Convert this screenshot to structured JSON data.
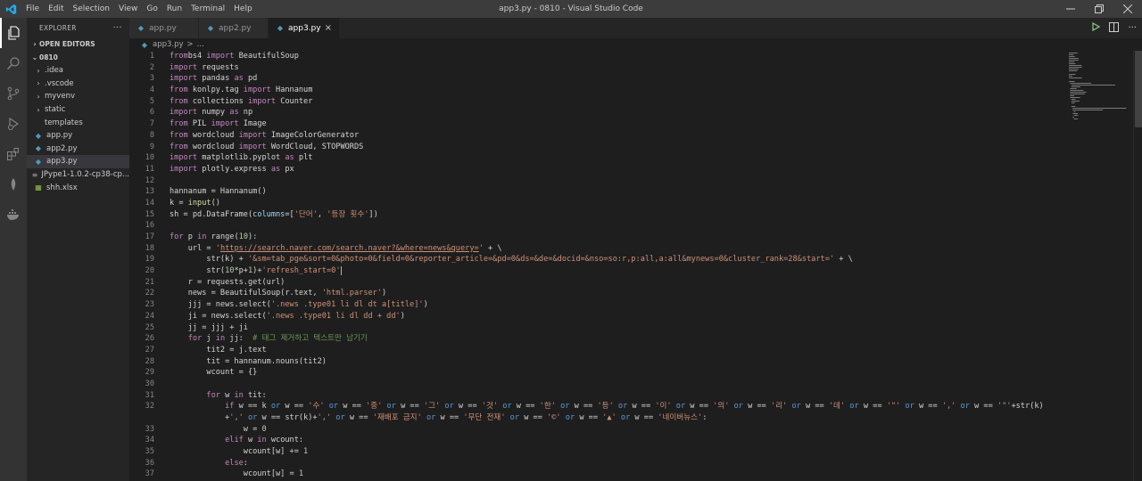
{
  "window": {
    "title": "app3.py - 0810 - Visual Studio Code",
    "menu": [
      "File",
      "Edit",
      "Selection",
      "View",
      "Go",
      "Run",
      "Terminal",
      "Help"
    ]
  },
  "sidebar": {
    "header": "EXPLORER",
    "header_action": "···",
    "open_editors": "OPEN EDITORS",
    "folder": "0810",
    "items": [
      {
        "label": ".idea",
        "type": "folder"
      },
      {
        "label": ".vscode",
        "type": "folder"
      },
      {
        "label": "myvenv",
        "type": "folder"
      },
      {
        "label": "static",
        "type": "folder"
      },
      {
        "label": "templates",
        "type": "folder-open"
      },
      {
        "label": "app.py",
        "type": "python"
      },
      {
        "label": "app2.py",
        "type": "python"
      },
      {
        "label": "app3.py",
        "type": "python"
      },
      {
        "label": "JPype1-1.0.2-cp38-cp...",
        "type": "file"
      },
      {
        "label": "shh.xlsx",
        "type": "excel"
      }
    ]
  },
  "tabs": [
    {
      "label": "app.py"
    },
    {
      "label": "app2.py"
    },
    {
      "label": "app3.py",
      "active": true
    }
  ],
  "breadcrumb": {
    "file": "app3.py",
    "sep": ">",
    "more": "..."
  },
  "colors": {
    "title_bar": "#3c3c3c",
    "activity_bar": "#333333",
    "sidebar": "#252526",
    "editor": "#1e1e1e",
    "python_icon": "#519aba",
    "excel_icon": "#8dc149"
  },
  "code_lines": [
    {
      "n": "1",
      "t": [
        [
          "kw-ctl",
          "from"
        ],
        [
          "",
          "bs4 "
        ],
        [
          "kw-ctl",
          "import"
        ],
        [
          "",
          " BeautifulSoup"
        ]
      ]
    },
    {
      "n": "2",
      "t": [
        [
          "kw-ctl",
          "import"
        ],
        [
          "",
          " requests"
        ]
      ]
    },
    {
      "n": "3",
      "t": [
        [
          "kw-ctl",
          "import"
        ],
        [
          "",
          " pandas "
        ],
        [
          "kw-ctl",
          "as"
        ],
        [
          "",
          " pd"
        ]
      ]
    },
    {
      "n": "4",
      "t": [
        [
          "kw-ctl",
          "from"
        ],
        [
          "",
          " konlpy.tag "
        ],
        [
          "kw-ctl",
          "import"
        ],
        [
          "",
          " Hannanum"
        ]
      ]
    },
    {
      "n": "5",
      "t": [
        [
          "kw-ctl",
          "from"
        ],
        [
          "",
          " collections "
        ],
        [
          "kw-ctl",
          "import"
        ],
        [
          "",
          " Counter"
        ]
      ]
    },
    {
      "n": "6",
      "t": [
        [
          "kw-ctl",
          "import"
        ],
        [
          "",
          " numpy "
        ],
        [
          "kw-ctl",
          "as"
        ],
        [
          "",
          " np"
        ]
      ]
    },
    {
      "n": "7",
      "t": [
        [
          "kw-ctl",
          "from"
        ],
        [
          "",
          " PIL "
        ],
        [
          "kw-ctl",
          "import"
        ],
        [
          "",
          " Image"
        ]
      ]
    },
    {
      "n": "8",
      "t": [
        [
          "kw-ctl",
          "from"
        ],
        [
          "",
          " wordcloud "
        ],
        [
          "kw-ctl",
          "import"
        ],
        [
          "",
          " ImageColorGenerator"
        ]
      ]
    },
    {
      "n": "9",
      "t": [
        [
          "kw-ctl",
          "from"
        ],
        [
          "",
          " wordcloud "
        ],
        [
          "kw-ctl",
          "import"
        ],
        [
          "",
          " WordCloud, STOPWORDS"
        ]
      ]
    },
    {
      "n": "10",
      "t": [
        [
          "kw-ctl",
          "import"
        ],
        [
          "",
          " matplotlib.pyplot "
        ],
        [
          "kw-ctl",
          "as"
        ],
        [
          "",
          " plt"
        ]
      ]
    },
    {
      "n": "11",
      "t": [
        [
          "kw-ctl",
          "import"
        ],
        [
          "",
          " plotly.express "
        ],
        [
          "kw-ctl",
          "as"
        ],
        [
          "",
          " px"
        ]
      ]
    },
    {
      "n": "12",
      "t": []
    },
    {
      "n": "13",
      "t": [
        [
          "",
          "hannanum = Hannanum()"
        ]
      ]
    },
    {
      "n": "14",
      "t": [
        [
          "",
          "k = "
        ],
        [
          "fn",
          "input"
        ],
        [
          "",
          "()"
        ]
      ]
    },
    {
      "n": "15",
      "t": [
        [
          "",
          "sh = pd.DataFrame("
        ],
        [
          "var",
          "columns"
        ],
        [
          "",
          "=["
        ],
        [
          "str",
          "'단어'"
        ],
        [
          "",
          ", "
        ],
        [
          "str",
          "'등장 횟수'"
        ],
        [
          "",
          "])"
        ]
      ]
    },
    {
      "n": "16",
      "t": []
    },
    {
      "n": "17",
      "t": [
        [
          "kw-ctl",
          "for"
        ],
        [
          "",
          " p "
        ],
        [
          "kw-ctl",
          "in"
        ],
        [
          "",
          " range("
        ],
        [
          "num",
          "10"
        ],
        [
          "",
          "):"
        ]
      ]
    },
    {
      "n": "18",
      "t": [
        [
          "",
          "    url = "
        ],
        [
          "str",
          "'"
        ],
        [
          "url",
          "https://search.naver.com/search.naver?&where=news&query="
        ],
        [
          "str",
          "'"
        ],
        [
          "",
          " + \\"
        ]
      ]
    },
    {
      "n": "19",
      "t": [
        [
          "",
          "        str(k) + "
        ],
        [
          "str",
          "'&sm=tab_pge&sort=0&photo=0&field=0&reporter_article=&pd=0&ds=&de=&docid=&nso=so:r,p:all,a:all&mynews=0&cluster_rank=28&start='"
        ],
        [
          "",
          " + \\"
        ]
      ]
    },
    {
      "n": "20",
      "t": [
        [
          "",
          "        str("
        ],
        [
          "num",
          "10"
        ],
        [
          "",
          "*p+"
        ],
        [
          "num",
          "1"
        ],
        [
          "",
          ")+"
        ],
        [
          "str",
          "'refresh_start=0'"
        ],
        [
          "cursor",
          ""
        ]
      ]
    },
    {
      "n": "21",
      "t": [
        [
          "",
          "    r = requests.get(url)"
        ]
      ]
    },
    {
      "n": "22",
      "t": [
        [
          "",
          "    news = BeautifulSoup(r.text, "
        ],
        [
          "str",
          "'html.parser'"
        ],
        [
          "",
          ")"
        ]
      ]
    },
    {
      "n": "23",
      "t": [
        [
          "",
          "    jjj = news.select("
        ],
        [
          "str",
          "'.news .type01 li dl dt a[title]'"
        ],
        [
          "",
          ")"
        ]
      ]
    },
    {
      "n": "24",
      "t": [
        [
          "",
          "    ji = news.select("
        ],
        [
          "str",
          "'.news .type01 li dl dd + dd'"
        ],
        [
          "",
          ")"
        ]
      ]
    },
    {
      "n": "25",
      "t": [
        [
          "",
          "    jj = jjj + ji"
        ]
      ]
    },
    {
      "n": "26",
      "t": [
        [
          "",
          "    "
        ],
        [
          "kw-ctl",
          "for"
        ],
        [
          "",
          " j "
        ],
        [
          "kw-ctl",
          "in"
        ],
        [
          "",
          " jj:  "
        ],
        [
          "cmt",
          "# 태그 제거하고 텍스트만 남기기"
        ]
      ]
    },
    {
      "n": "27",
      "t": [
        [
          "",
          "        tit2 = j.text"
        ]
      ]
    },
    {
      "n": "28",
      "t": [
        [
          "",
          "        tit = hannanum.nouns(tit2)"
        ]
      ]
    },
    {
      "n": "29",
      "t": [
        [
          "",
          "        wcount = {}"
        ]
      ]
    },
    {
      "n": "30",
      "t": []
    },
    {
      "n": "31",
      "t": [
        [
          "",
          "        "
        ],
        [
          "kw-ctl",
          "for"
        ],
        [
          "",
          " w "
        ],
        [
          "kw-ctl",
          "in"
        ],
        [
          "",
          " tit:"
        ]
      ]
    },
    {
      "n": "32",
      "t": [
        [
          "",
          "            "
        ],
        [
          "kw-ctl",
          "if"
        ],
        [
          "",
          " w == k "
        ],
        [
          "kw",
          "or"
        ],
        [
          "",
          " w == "
        ],
        [
          "str",
          "'수'"
        ],
        [
          "kw",
          " or"
        ],
        [
          "",
          " w == "
        ],
        [
          "str",
          "'중'"
        ],
        [
          "kw",
          " or"
        ],
        [
          "",
          " w == "
        ],
        [
          "str",
          "'그'"
        ],
        [
          "kw",
          " or"
        ],
        [
          "",
          " w == "
        ],
        [
          "str",
          "'것'"
        ],
        [
          "kw",
          " or"
        ],
        [
          "",
          " w == "
        ],
        [
          "str",
          "'한'"
        ],
        [
          "kw",
          " or"
        ],
        [
          "",
          " w == "
        ],
        [
          "str",
          "'등'"
        ],
        [
          "kw",
          " or"
        ],
        [
          "",
          " w == "
        ],
        [
          "str",
          "'이'"
        ],
        [
          "kw",
          " or"
        ],
        [
          "",
          " w == "
        ],
        [
          "str",
          "'의'"
        ],
        [
          "kw",
          " or"
        ],
        [
          "",
          " w == "
        ],
        [
          "str",
          "'리'"
        ],
        [
          "kw",
          " or"
        ],
        [
          "",
          " w == "
        ],
        [
          "str",
          "'데'"
        ],
        [
          "kw",
          " or"
        ],
        [
          "",
          " w == "
        ],
        [
          "str",
          "'\"'"
        ],
        [
          "kw",
          " or"
        ],
        [
          "",
          " w == "
        ],
        [
          "str",
          "','"
        ],
        [
          "kw",
          " or"
        ],
        [
          "",
          " w == "
        ],
        [
          "str",
          "'\"'"
        ],
        [
          "",
          "+str(k)"
        ]
      ]
    },
    {
      "n": "",
      "t": [
        [
          "",
          "            +"
        ],
        [
          "str",
          "','"
        ],
        [
          "kw",
          " or"
        ],
        [
          "",
          " w == str(k)+"
        ],
        [
          "str",
          "','"
        ],
        [
          "kw",
          " or"
        ],
        [
          "",
          " w == "
        ],
        [
          "str",
          "'재배포 금지'"
        ],
        [
          "kw",
          " or"
        ],
        [
          "",
          " w == "
        ],
        [
          "str",
          "'무단 전재'"
        ],
        [
          "kw",
          " or"
        ],
        [
          "",
          " w == "
        ],
        [
          "str",
          "'©'"
        ],
        [
          "kw",
          " or"
        ],
        [
          "",
          " w == "
        ],
        [
          "str",
          "'▲'"
        ],
        [
          "kw",
          " or"
        ],
        [
          "",
          " w == "
        ],
        [
          "str",
          "'네이버뉴스'"
        ],
        [
          "",
          ":"
        ]
      ]
    },
    {
      "n": "33",
      "t": [
        [
          "",
          "                w = "
        ],
        [
          "num",
          "0"
        ]
      ]
    },
    {
      "n": "34",
      "t": [
        [
          "",
          "            "
        ],
        [
          "kw-ctl",
          "elif"
        ],
        [
          "",
          " w "
        ],
        [
          "kw-ctl",
          "in"
        ],
        [
          "",
          " wcount:"
        ]
      ]
    },
    {
      "n": "35",
      "t": [
        [
          "",
          "                wcount[w] += "
        ],
        [
          "num",
          "1"
        ]
      ]
    },
    {
      "n": "36",
      "t": [
        [
          "",
          "            "
        ],
        [
          "kw-ctl",
          "else"
        ],
        [
          "",
          ":"
        ]
      ]
    },
    {
      "n": "37",
      "t": [
        [
          "",
          "                wcount[w] = "
        ],
        [
          "num",
          "1"
        ]
      ]
    }
  ]
}
